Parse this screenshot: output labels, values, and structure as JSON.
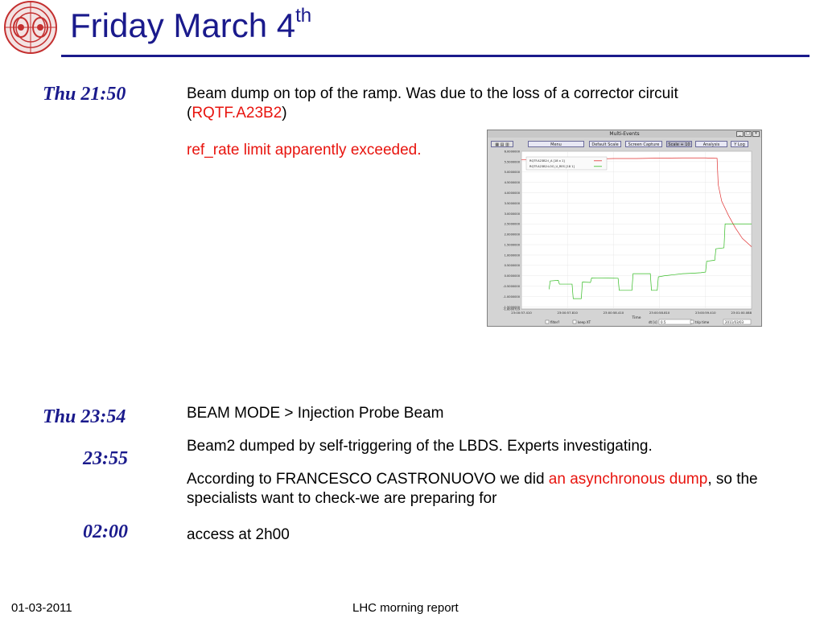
{
  "slide": {
    "title_main": "Friday March 4",
    "title_sup": "th"
  },
  "entries": [
    {
      "time": "Thu 21:50"
    },
    {
      "time": "Thu 23:54"
    },
    {
      "time": "23:55"
    },
    {
      "time": "02:00"
    }
  ],
  "block1": {
    "line1": "Beam dump on top of the ramp. Was due to the loss of a corrector circuit",
    "paren_open": "(",
    "circuit": "RQTF.A23B2",
    "paren_close": ")",
    "line3": "ref_rate limit apparently exceeded."
  },
  "block2": {
    "line1": "BEAM MODE > Injection Probe Beam",
    "line2": "Beam2 dumped by self-triggering of the LBDS. Experts investigating.",
    "line3_pre": "According to FRANCESCO CASTRONUOVO we did ",
    "line3_red": "an asynchronous dump",
    "line3_post": ", so the specialists want to check-we are preparing for",
    "line4": "access at 2h00"
  },
  "footer": {
    "date": "01-03-2011",
    "center": "LHC morning report"
  },
  "window": {
    "title": "Multi-Events",
    "buttons": {
      "menu": "Menu",
      "default_scale": "Default Scale",
      "screen_capture": "Screen Capture",
      "scale": "Scale + 10",
      "analysis": "Analysis",
      "ylog": "Y Log"
    },
    "bottom": {
      "filter": "filter?",
      "keep": "keep XT",
      "dt_label": "dt [s]",
      "dt_value": "0.5",
      "trip_time": "trip time",
      "date_value": "2011/03/03"
    },
    "colors": {
      "series1": "#e03030",
      "series2": "#33bb22"
    }
  },
  "chart_data": {
    "type": "line",
    "title": "",
    "xlabel": "Time",
    "ylabel": "",
    "ylim": [
      -1.6,
      6.0
    ],
    "y_ticks": [
      "6.0000000",
      "5.5000000",
      "5.0000000",
      "4.5000000",
      "4.0000000",
      "3.5000000",
      "3.0000000",
      "2.5000000",
      "2.0000000",
      "1.5000000",
      "1.0000000",
      "0.5000000",
      "0.0000000",
      "-0.5000000",
      "-1.0000000",
      "-1.5000000",
      "-1.6000729"
    ],
    "x_ticks": [
      "23:00:57.410",
      "23:00:57.810",
      "23:00:58.410",
      "23:00:58.810",
      "23:00:59.410",
      "23:01:00.088"
    ],
    "legend": [
      "RQTF.A23B2:I_A [18 x 1]",
      "RQTF.A23B2:LOO_U_RES [18 1]"
    ],
    "series": [
      {
        "name": "RQTF.A23B2:I_A [18 x 1]",
        "color": "#e03030",
        "points": [
          [
            0.0,
            5.6
          ],
          [
            0.1,
            5.6
          ],
          [
            0.2,
            5.62
          ],
          [
            0.3,
            5.62
          ],
          [
            0.4,
            5.65
          ],
          [
            0.5,
            5.65
          ],
          [
            0.6,
            5.67
          ],
          [
            0.7,
            5.68
          ],
          [
            0.8,
            5.68
          ],
          [
            0.85,
            5.66
          ],
          [
            0.855,
            4.4
          ],
          [
            0.87,
            3.6
          ],
          [
            0.9,
            2.9
          ],
          [
            0.93,
            2.3
          ],
          [
            0.96,
            1.8
          ],
          [
            1.0,
            1.4
          ]
        ]
      },
      {
        "name": "RQTF.A23B2:LOO_U_RES [18 1]",
        "color": "#33bb22",
        "points": [
          [
            0.12,
            -0.65
          ],
          [
            0.125,
            -0.25
          ],
          [
            0.16,
            -0.22
          ],
          [
            0.165,
            -0.4
          ],
          [
            0.22,
            -0.4
          ],
          [
            0.225,
            -1.1
          ],
          [
            0.26,
            -1.1
          ],
          [
            0.265,
            -0.3
          ],
          [
            0.3,
            -0.32
          ],
          [
            0.305,
            -0.1
          ],
          [
            0.42,
            -0.12
          ],
          [
            0.425,
            -0.7
          ],
          [
            0.48,
            -0.7
          ],
          [
            0.485,
            0.1
          ],
          [
            0.56,
            0.1
          ],
          [
            0.565,
            -0.7
          ],
          [
            0.59,
            -0.7
          ],
          [
            0.595,
            -0.05
          ],
          [
            0.62,
            0.0
          ],
          [
            0.66,
            0.05
          ],
          [
            0.7,
            0.1
          ],
          [
            0.74,
            0.12
          ],
          [
            0.78,
            0.15
          ],
          [
            0.8,
            0.18
          ],
          [
            0.805,
            0.7
          ],
          [
            0.84,
            0.75
          ],
          [
            0.845,
            1.3
          ],
          [
            0.88,
            1.35
          ],
          [
            0.885,
            2.5
          ],
          [
            1.0,
            2.5
          ]
        ]
      }
    ]
  }
}
